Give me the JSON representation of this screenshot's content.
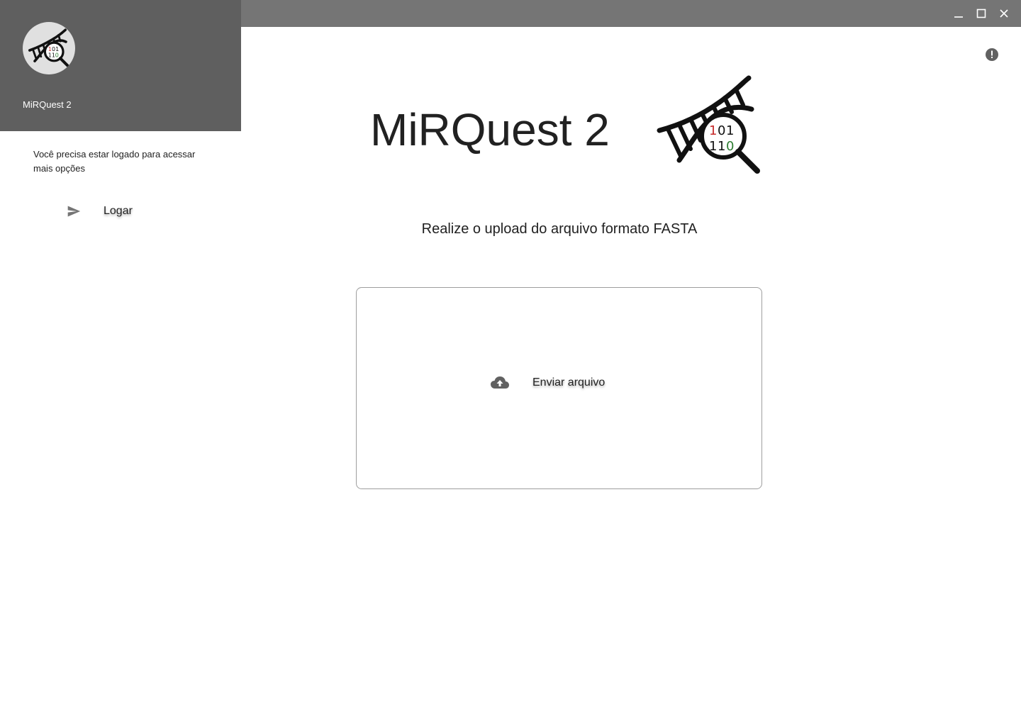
{
  "app": {
    "name": "MiRQuest 2"
  },
  "drawer": {
    "app_name": "MiRQuest 2",
    "login_message": "Você precisa estar logado para acessar mais opções",
    "login_label": "Logar"
  },
  "main": {
    "title": "MiRQuest 2",
    "subtitle": "Realize o upload do arquivo formato FASTA",
    "upload_label": "Enviar arquivo"
  },
  "logo": {
    "row1": [
      "1",
      "0",
      "1"
    ],
    "row2": [
      "1",
      "1",
      "0"
    ]
  },
  "icons": {
    "login": "send-icon",
    "upload": "cloud-upload-icon",
    "info": "alert-circle-icon",
    "minimize": "minimize-icon",
    "maximize": "maximize-icon",
    "close": "close-icon"
  },
  "colors": {
    "titlebar": "#757575",
    "drawer_header": "#5f5f5f",
    "logo_red": "#c62828",
    "logo_green": "#2e7d32"
  }
}
